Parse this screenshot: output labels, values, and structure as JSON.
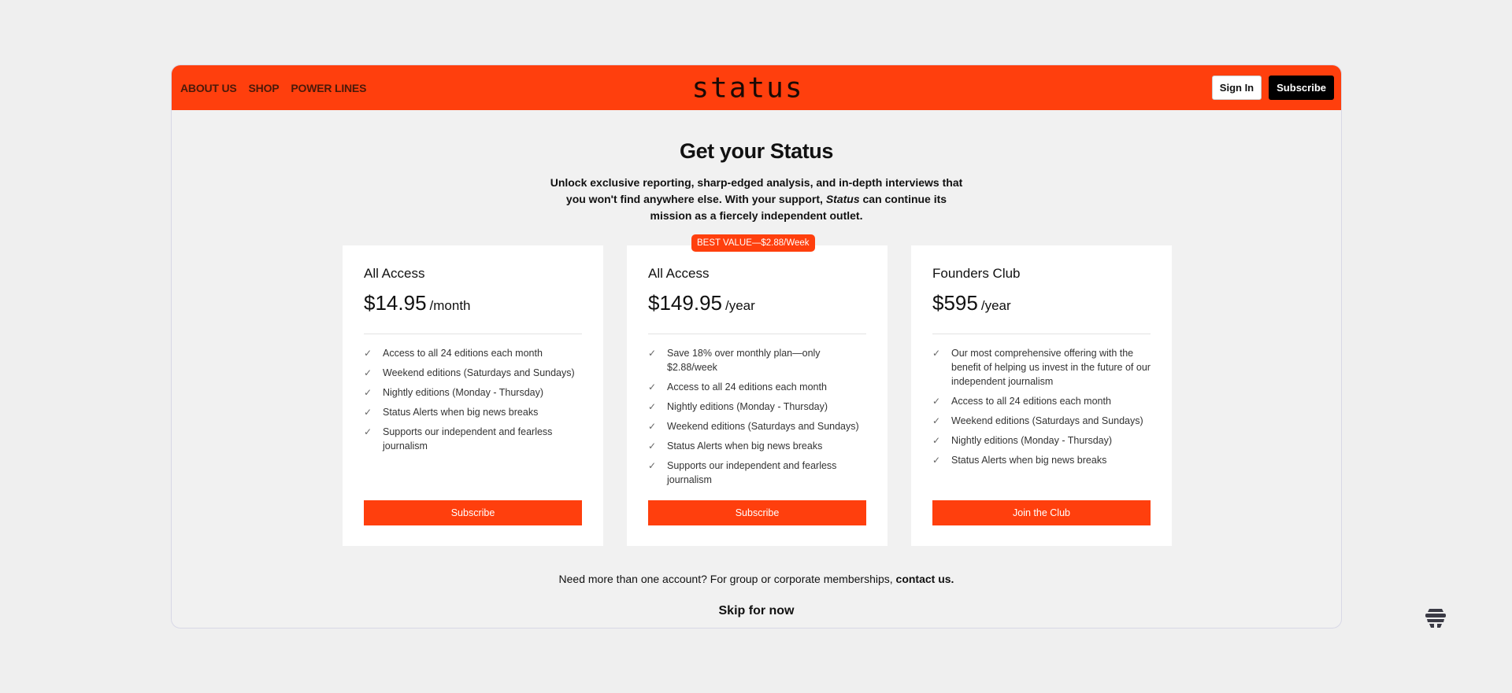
{
  "nav": {
    "links": [
      "ABOUT US",
      "SHOP",
      "POWER LINES"
    ],
    "logo": "status",
    "sign_in": "Sign In",
    "subscribe": "Subscribe"
  },
  "hero": {
    "title": "Get your Status",
    "intro_part1": "Unlock exclusive reporting, sharp-edged analysis, and in-depth interviews that you won't find anywhere else. With your support, ",
    "intro_brand": "Status",
    "intro_part2": " can continue its mission as a fiercely independent outlet."
  },
  "plans": [
    {
      "name": "All Access",
      "price": "$14.95",
      "period": "/month",
      "features": [
        "Access to all 24 editions each month",
        "Weekend editions (Saturdays and Sundays)",
        "Nightly editions (Monday - Thursday)",
        "Status Alerts when big news breaks",
        "Supports our independent and fearless journalism"
      ],
      "button": "Subscribe"
    },
    {
      "badge": "BEST VALUE—$2.88/Week",
      "name": "All Access",
      "price": "$149.95",
      "period": "/year",
      "features": [
        "Save 18% over monthly plan—only $2.88/week",
        "Access to all 24 editions each month",
        "Nightly editions (Monday - Thursday)",
        "Weekend editions (Saturdays and Sundays)",
        "Status Alerts when big news breaks",
        "Supports our independent and fearless journalism"
      ],
      "button": "Subscribe"
    },
    {
      "name": "Founders Club",
      "price": "$595",
      "period": "/year",
      "features": [
        "Our most comprehensive offering with the benefit of helping us invest in the future of our independent journalism",
        "Access to all 24 editions each month",
        "Weekend editions (Saturdays and Sundays)",
        "Nightly editions (Monday - Thursday)",
        "Status Alerts when big news breaks"
      ],
      "button": "Join the Club"
    }
  ],
  "footer": {
    "note": "Need more than one account? For group or corporate memberships, ",
    "contact": "contact us.",
    "skip": "Skip for now"
  },
  "colors": {
    "accent": "#ff3f0d",
    "dark": "#000000"
  },
  "icons": {
    "check": "check-icon",
    "corner": "app-logo-icon"
  }
}
